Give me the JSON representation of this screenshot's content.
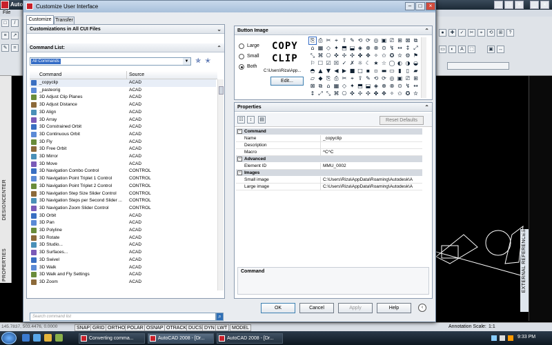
{
  "background_app": {
    "title": "Auto",
    "menu": "File",
    "status_coords": "145.7837, 503.4476, 0.0000",
    "status_buttons": [
      "SNAP",
      "GRID",
      "ORTHO",
      "POLAR",
      "OSNAP",
      "OTRACK",
      "DUCS",
      "DYN",
      "LWT",
      "MODEL"
    ],
    "annotation_scale_label": "Annotation Scale:",
    "annotation_scale_value": "1:1",
    "side_left_label": "DESIGNCENTER",
    "side_left_label2": "PROPERTIES",
    "side_right_label": "EXTERNAL REFERENCES"
  },
  "taskbar": {
    "items": [
      "Converting comma...",
      "AutoCAD 2008 - [Dr...",
      "AutoCAD 2008 - [Dr..."
    ],
    "clock": "9:33 PM"
  },
  "dialog": {
    "title": "Customize User Interface",
    "tabs": [
      "Customize",
      "Transfer"
    ],
    "customizations_header": "Customizations in All CUI Files",
    "command_list_header": "Command List:",
    "filter_selected": "All Commands",
    "columns": {
      "command": "Command",
      "source": "Source"
    },
    "commands": [
      {
        "name": "_copyclip",
        "source": "ACAD"
      },
      {
        "name": "_pasteorig",
        "source": "ACAD"
      },
      {
        "name": "3D Adjust Clip Planes",
        "source": "ACAD"
      },
      {
        "name": "3D Adjust Distance",
        "source": "ACAD"
      },
      {
        "name": "3D Align",
        "source": "ACAD"
      },
      {
        "name": "3D Array",
        "source": "ACAD"
      },
      {
        "name": "3D Constrained Orbit",
        "source": "ACAD"
      },
      {
        "name": "3D Continuous Orbit",
        "source": "ACAD"
      },
      {
        "name": "3D Fly",
        "source": "ACAD"
      },
      {
        "name": "3D Free Orbit",
        "source": "ACAD"
      },
      {
        "name": "3D Mirror",
        "source": "ACAD"
      },
      {
        "name": "3D Move",
        "source": "ACAD"
      },
      {
        "name": "3D Navigation Combo Control",
        "source": "CONTROL"
      },
      {
        "name": "3D Navigation Point Triplet 1 Control",
        "source": "CONTROL"
      },
      {
        "name": "3D Navigation Point Triplet 2 Control",
        "source": "CONTROL"
      },
      {
        "name": "3D Navigation Step Size Slider Control",
        "source": "CONTROL"
      },
      {
        "name": "3D Navigation Steps per Second Slider ...",
        "source": "CONTROL"
      },
      {
        "name": "3D Navigation Zoom Slider Control",
        "source": "CONTROL"
      },
      {
        "name": "3D Orbit",
        "source": "ACAD"
      },
      {
        "name": "3D Pan",
        "source": "ACAD"
      },
      {
        "name": "3D Polyline",
        "source": "ACAD"
      },
      {
        "name": "3D Rotate",
        "source": "ACAD"
      },
      {
        "name": "3D Studio...",
        "source": "ACAD"
      },
      {
        "name": "3D Surfaces...",
        "source": "ACAD"
      },
      {
        "name": "3D Swivel",
        "source": "ACAD"
      },
      {
        "name": "3D Walk",
        "source": "ACAD"
      },
      {
        "name": "3D Walk and Fly Settings",
        "source": "ACAD"
      },
      {
        "name": "3D Zoom",
        "source": "ACAD"
      }
    ],
    "search_placeholder": "Search command list",
    "button_image": {
      "header": "Button Image",
      "options": [
        "Large",
        "Small",
        "Both"
      ],
      "selected": "Both",
      "preview_line1": "COPY",
      "preview_line2": "CLIP",
      "path": "C:\\Users\\Riza\\App...",
      "edit_label": "Edit..."
    },
    "properties": {
      "header": "Properties",
      "reset_label": "Reset Defaults",
      "categories": [
        {
          "name": "Command",
          "rows": [
            {
              "key": "Name",
              "value": "_copyclip"
            },
            {
              "key": "Description",
              "value": ""
            },
            {
              "key": "Macro",
              "value": "^C^C"
            }
          ]
        },
        {
          "name": "Advanced",
          "rows": [
            {
              "key": "Element ID",
              "value": "MMU_0002"
            }
          ]
        },
        {
          "name": "Images",
          "rows": [
            {
              "key": "Small image",
              "value": "C:\\Users\\Riza\\AppData\\Roaming\\Autodesk\\A"
            },
            {
              "key": "Large image",
              "value": "C:\\Users\\Riza\\AppData\\Roaming\\Autodesk\\A"
            }
          ]
        }
      ],
      "description_title": "Command"
    },
    "footer_buttons": [
      "OK",
      "Cancel",
      "Apply",
      "Help"
    ]
  }
}
